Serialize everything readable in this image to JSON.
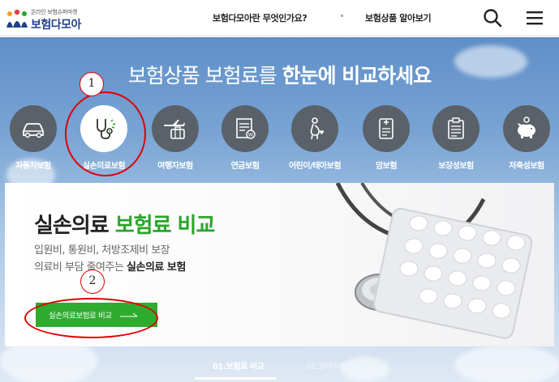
{
  "header": {
    "logo_subtitle": "온라인 보험슈퍼마켓",
    "logo_title": "보험다모아",
    "nav": [
      {
        "label": "보험다모아란 무엇인가요?"
      },
      {
        "label": "보험상품 알아보기"
      }
    ],
    "search_icon": "search-icon",
    "menu_icon": "hamburger-menu-icon"
  },
  "hero": {
    "title_regular": "보험상품 보험료를 ",
    "title_bold": "한눈에 비교하세요",
    "categories": [
      {
        "label": "자동차보험",
        "icon": "car-icon",
        "active": false
      },
      {
        "label": "실손의료보험",
        "icon": "stethoscope-icon",
        "active": true
      },
      {
        "label": "여행자보험",
        "icon": "airplane-luggage-icon",
        "active": false
      },
      {
        "label": "연금보험",
        "icon": "pension-document-icon",
        "active": false
      },
      {
        "label": "어린이/태아보험",
        "icon": "pregnant-woman-icon",
        "active": false
      },
      {
        "label": "암보험",
        "icon": "medical-chart-icon",
        "active": false
      },
      {
        "label": "보장성보험",
        "icon": "clipboard-icon",
        "active": false
      },
      {
        "label": "저축성보험",
        "icon": "piggy-bank-icon",
        "active": false
      }
    ]
  },
  "card": {
    "title_black": "실손의료 ",
    "title_green": "보험료 비교",
    "desc_line1": "입원비, 통원비, 처방조제비 보장",
    "desc_line2_regular": "의료비 부담 줄여주는 ",
    "desc_line2_bold": "실손의료 보험",
    "cta_label": "실손의료보험료 비교"
  },
  "tabs": [
    {
      "label": "01.보험료 비교",
      "active": true
    },
    {
      "label": "02.고객지원",
      "active": false
    }
  ],
  "annotations": [
    {
      "number": "1"
    },
    {
      "number": "2"
    }
  ],
  "colors": {
    "accent_green": "#2aa52a",
    "brand_blue": "#1f3f8f",
    "annotation_red": "#e00000",
    "icon_circle": "#5a6169"
  }
}
